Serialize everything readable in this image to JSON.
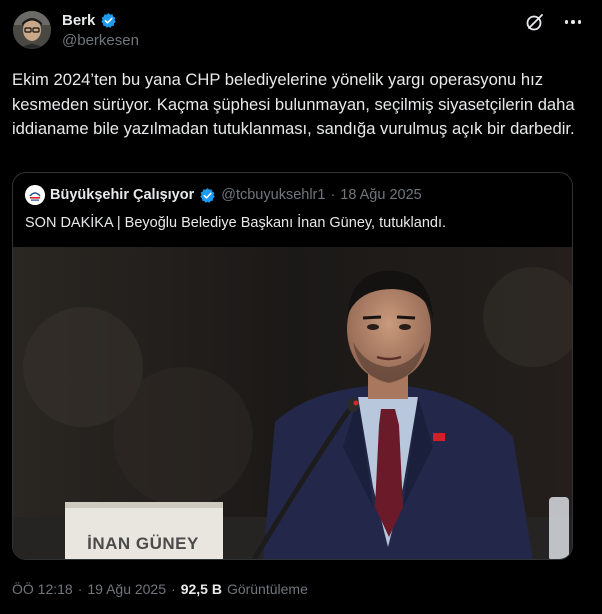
{
  "author": {
    "display_name": "Berk",
    "handle": "@berkesen",
    "verified_icon": "verified-badge-icon"
  },
  "icons": {
    "grok": "grok-icon",
    "more": "more-options-icon"
  },
  "tweet": {
    "text": "Ekim 2024’ten bu yana CHP belediyelerine yönelik yargı operasyonu hız kesmeden sürüyor. Kaçma şüphesi bulunmayan, seçilmiş siyasetçilerin daha iddianame bile yazılmadan tutuklanması, sandığa vurulmuş açık bir darbedir."
  },
  "quote": {
    "display_name": "Büyükşehir Çalışıyor",
    "handle": "@tcbuyuksehlr1",
    "separator": "·",
    "date": "18 Ağu 2025",
    "text": "SON DAKİKA | Beyoğlu Belediye Başkanı İnan Güney, tutuklandı.",
    "media": {
      "nameplate_text": "İNAN GÜNEY"
    }
  },
  "meta": {
    "time": "ÖÖ 12:18",
    "separator": "·",
    "date": "19 Ağu 2025",
    "separator2": "·",
    "views_count": "92,5 B",
    "views_label": "Görüntüleme"
  },
  "colors": {
    "background": "#000000",
    "text": "#e7e9ea",
    "secondary": "#71767b",
    "verified": "#1d9bf0",
    "border": "#2f3336"
  }
}
